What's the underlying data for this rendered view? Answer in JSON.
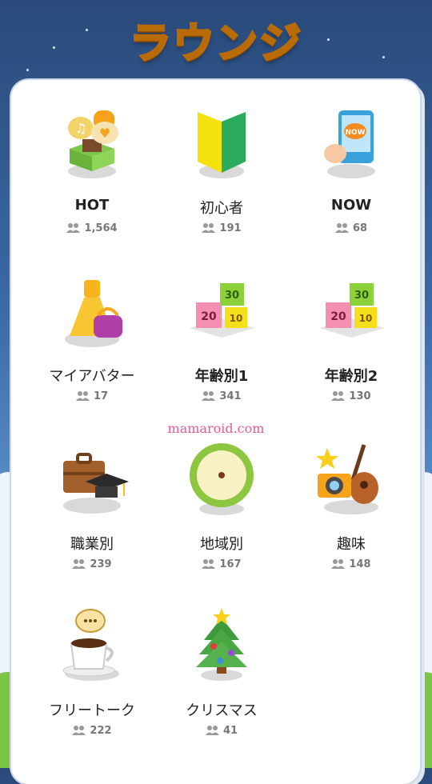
{
  "header": {
    "title": "ラウンジ"
  },
  "watermark": "mamaroid.com",
  "lounges": [
    {
      "name": "HOT",
      "count": "1,564",
      "icon": "gift-box-icon"
    },
    {
      "name": "初心者",
      "count": "191",
      "icon": "beginner-mark-icon"
    },
    {
      "name": "NOW",
      "count": "68",
      "icon": "phone-now-icon"
    },
    {
      "name": "マイアバター",
      "count": "17",
      "icon": "dress-bag-icon"
    },
    {
      "name": "年齢別1",
      "count": "341",
      "icon": "age-blocks-icon"
    },
    {
      "name": "年齢別2",
      "count": "130",
      "icon": "age-blocks-icon"
    },
    {
      "name": "職業別",
      "count": "239",
      "icon": "briefcase-graduation-icon"
    },
    {
      "name": "地域別",
      "count": "167",
      "icon": "compass-icon"
    },
    {
      "name": "趣味",
      "count": "148",
      "icon": "guitar-camera-icon"
    },
    {
      "name": "フリートーク",
      "count": "222",
      "icon": "coffee-cup-icon"
    },
    {
      "name": "クリスマス",
      "count": "41",
      "icon": "christmas-tree-icon"
    }
  ],
  "colors": {
    "accent_title": "#f8c324",
    "count_gray": "#777777",
    "watermark": "#e05ba0"
  }
}
